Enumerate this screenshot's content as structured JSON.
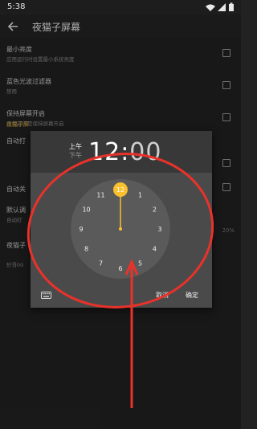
{
  "status_bar": {
    "time": "5:38"
  },
  "app_bar": {
    "title": "夜猫子屏幕"
  },
  "settings": [
    {
      "title": "最小亮度",
      "subtitle": "应用运行时设置最小系统亮度"
    },
    {
      "title": "蓝色光波过滤器",
      "subtitle": "禁用"
    },
    {
      "title": "保持屏幕开启",
      "subtitle": "应用运行是保持屏幕开启"
    }
  ],
  "partial_rows": {
    "section_header": "夜猫子屏",
    "auto_on": "自动打",
    "auto_off": "自动关",
    "default_title": "默认调",
    "default_sub": "自动打",
    "bottom_title": "夜猫子",
    "bottom_sub": "轩哥00",
    "percent": "20%"
  },
  "time_picker": {
    "am_label": "上午",
    "pm_label": "下午",
    "hour": "12",
    "separator": ":",
    "minute": "00",
    "dial_numbers": [
      "12",
      "1",
      "2",
      "3",
      "4",
      "5",
      "6",
      "7",
      "8",
      "9",
      "10",
      "11"
    ],
    "cancel_label": "取消",
    "ok_label": "确定"
  },
  "colors": {
    "accent": "#fbc02d",
    "annotation": "#e8322a",
    "section_header": "#d1a12c"
  }
}
